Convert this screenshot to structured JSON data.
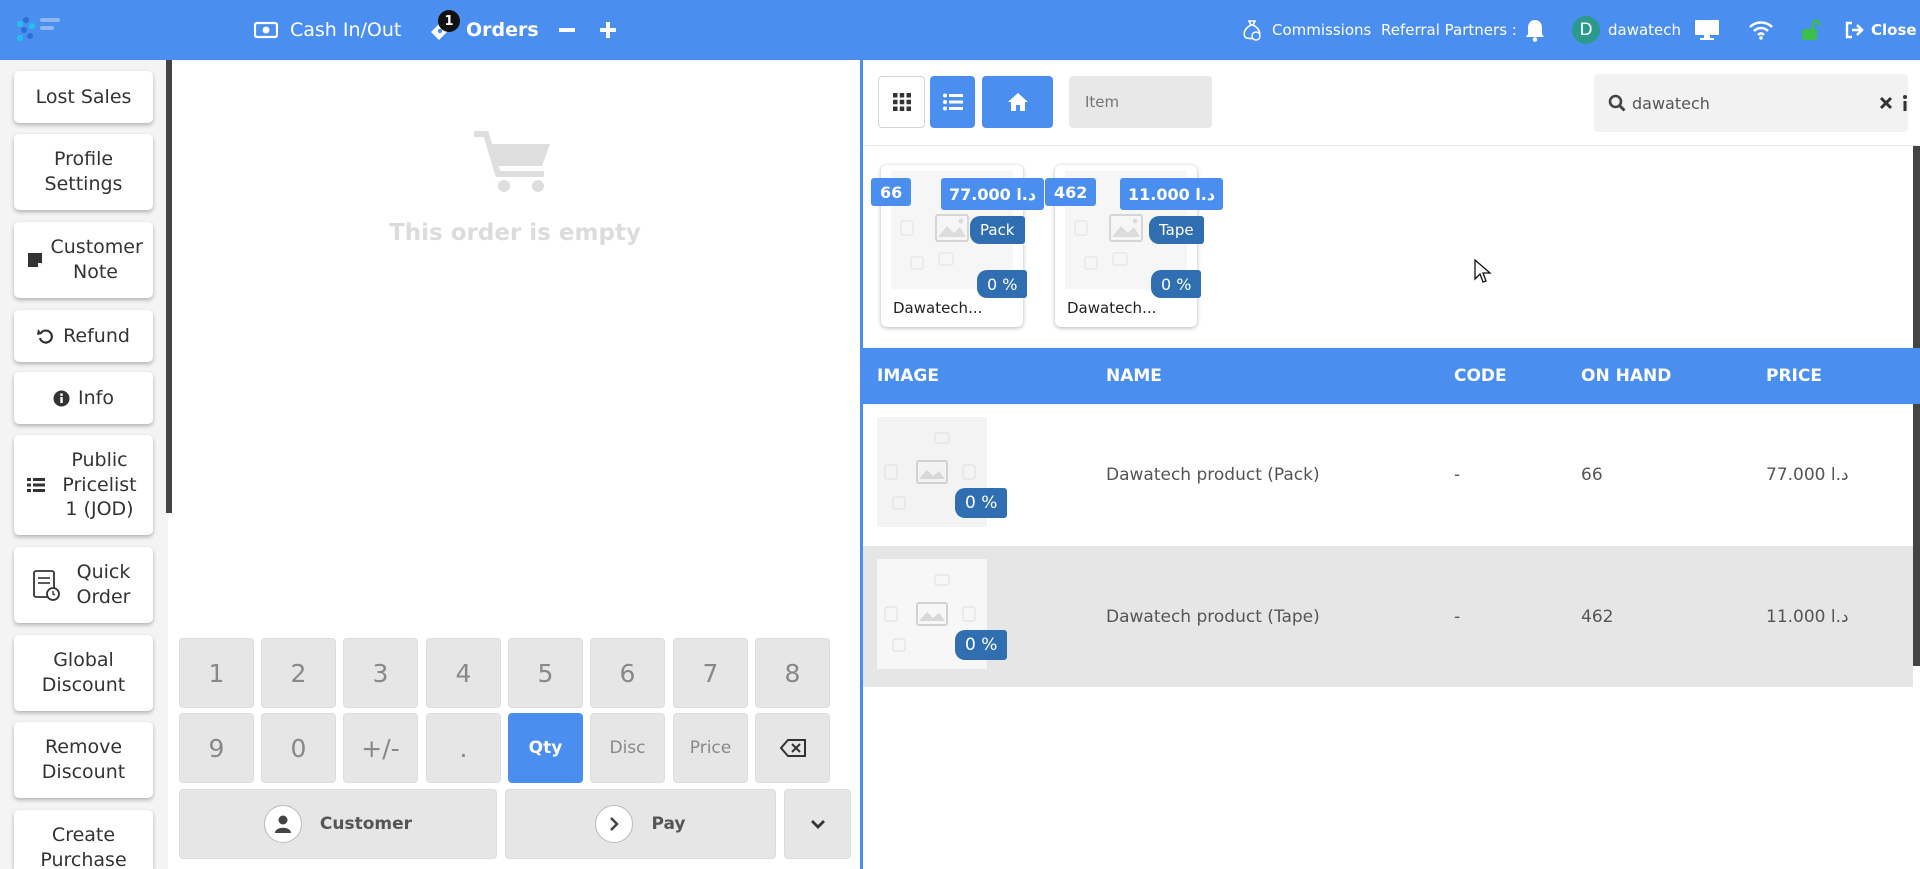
{
  "topbar": {
    "cash_in_out": "Cash In/Out",
    "orders_label": "Orders",
    "orders_count": "1",
    "commissions": "Commissions",
    "referral_partners": "Referral Partners :",
    "user_initial": "D",
    "user_name": "dawatech",
    "close": "Close"
  },
  "left_buttons": [
    {
      "label": "Lost Sales"
    },
    {
      "label": "Profile Settings"
    },
    {
      "label": "Customer Note"
    },
    {
      "label": "Refund"
    },
    {
      "label": "Info"
    },
    {
      "label": "Public Pricelist 1 (JOD)"
    },
    {
      "label": "Quick Order"
    },
    {
      "label": "Global Discount"
    },
    {
      "label": "Remove Discount"
    },
    {
      "label": "Create Purchase"
    }
  ],
  "order": {
    "empty_text": "This order is empty"
  },
  "numpad": {
    "keys": [
      "1",
      "2",
      "3",
      "4",
      "5",
      "6",
      "7",
      "8",
      "9",
      "0",
      "+/-",
      "."
    ],
    "qty": "Qty",
    "disc": "Disc",
    "price": "Price",
    "customer": "Customer",
    "pay": "Pay"
  },
  "products_bar": {
    "item_placeholder": "Item",
    "search_value": "dawatech"
  },
  "cards": [
    {
      "on_hand": "66",
      "price": "77.000 د.ا",
      "unit": "Pack",
      "discount": "0 %",
      "name": "Dawatech..."
    },
    {
      "on_hand": "462",
      "price": "11.000 د.ا",
      "unit": "Tape",
      "discount": "0 %",
      "name": "Dawatech..."
    }
  ],
  "table": {
    "headers": [
      "IMAGE",
      "NAME",
      "CODE",
      "ON HAND",
      "PRICE"
    ],
    "rows": [
      {
        "discount": "0 %",
        "name": "Dawatech product (Pack)",
        "code": "-",
        "on_hand": "66",
        "price": "77.000 د.ا"
      },
      {
        "discount": "0 %",
        "name": "Dawatech product (Tape)",
        "code": "-",
        "on_hand": "462",
        "price": "11.000 د.ا"
      }
    ]
  },
  "colors": {
    "accent": "#4a8ff0",
    "badge_dark": "#2f6fb1",
    "avatar": "#2b9a8c",
    "unlock": "#3bbf4a"
  }
}
